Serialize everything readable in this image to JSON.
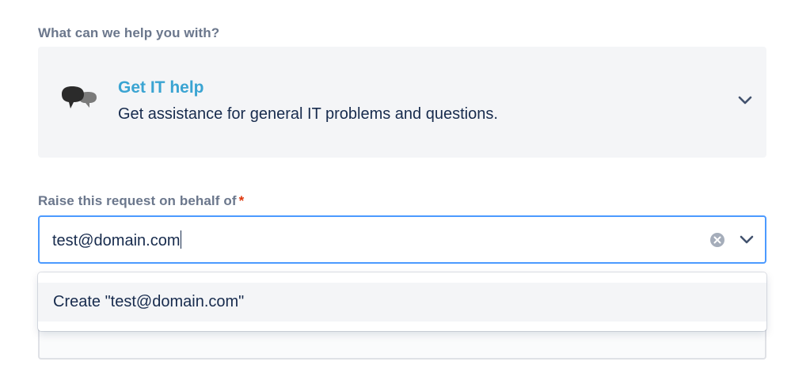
{
  "request_type": {
    "label": "What can we help you with?",
    "title": "Get IT help",
    "description": "Get assistance for general IT problems and questions.",
    "icon": "speech-bubbles-icon"
  },
  "behalf_field": {
    "label": "Raise this request on behalf of",
    "required_marker": "*",
    "value": "test@domain.com",
    "clear_icon": "clear-icon",
    "dropdown_icon": "chevron-down-icon"
  },
  "dropdown": {
    "options": [
      {
        "label": "Create \"test@domain.com\""
      }
    ]
  },
  "colors": {
    "accent_title": "#3aa4d2",
    "focus_border": "#4c9aff",
    "label": "#6b778c",
    "text": "#172b4d",
    "required": "#de350b",
    "panel_bg": "#f4f5f7"
  }
}
